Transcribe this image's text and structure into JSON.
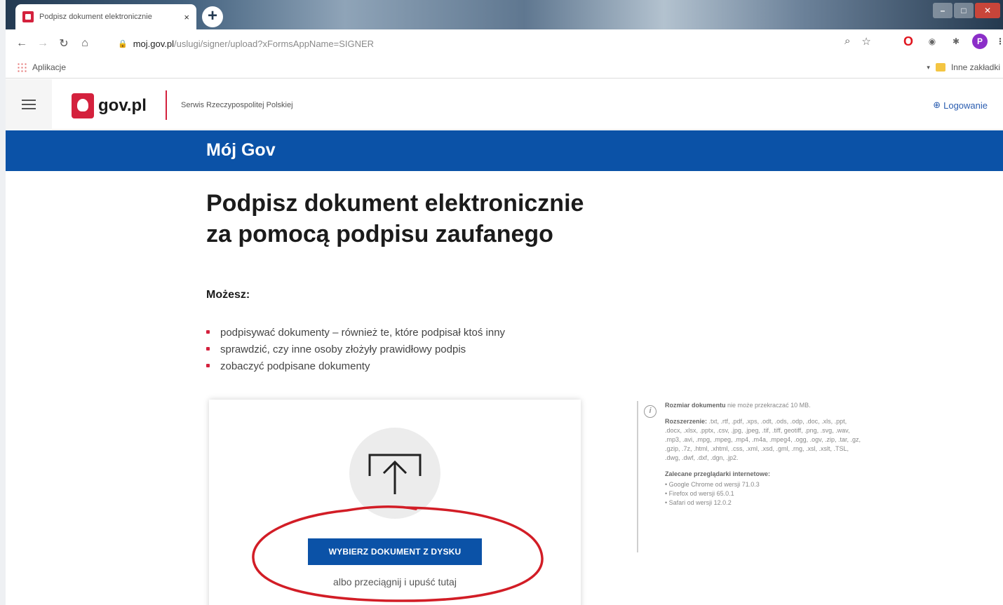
{
  "browser": {
    "tab_title": "Podpisz dokument elektronicznie",
    "tab_close": "×",
    "new_tab": "+",
    "url_host": "moj.gov.pl",
    "url_path": "/uslugi/signer/upload?xFormsAppName=SIGNER",
    "bookmarks": {
      "apps": "Aplikacje",
      "other": "Inne zakładki"
    }
  },
  "site": {
    "logo_text": "gov.pl",
    "tagline": "Serwis Rzeczypospolitej Polskiej",
    "login": "Logowanie",
    "banner_title": "Mój Gov"
  },
  "main": {
    "title_line1": "Podpisz dokument elektronicznie",
    "title_line2": "za pomocą podpisu zaufanego",
    "can_label": "Możesz:",
    "bullets": [
      "podpisywać dokumenty – również te, które podpisał ktoś inny",
      "sprawdzić, czy inne osoby złożyły prawidłowy podpis",
      "zobaczyć podpisane dokumenty"
    ],
    "upload_button": "WYBIERZ DOKUMENT Z DYSKU",
    "drop_text": "albo przeciągnij i upuść tutaj"
  },
  "info": {
    "size_label": "Rozmiar dokumentu",
    "size_text": "nie może przekraczać 10 MB.",
    "ext_label": "Rozszerzenie:",
    "ext_text": ".txt, .rtf, .pdf, .xps, .odt, .ods, .odp, .doc, .xls, .ppt, .docx, .xlsx, .pptx, .csv, .jpg, .jpeg, .tif, .tiff, geotiff, .png, .svg, .wav, .mp3, .avi, .mpg, .mpeg, .mp4, .m4a, .mpeg4, .ogg, .ogv, .zip, .tar, .gz, .gzip, .7z, .html, .xhtml, .css, .xml, .xsd, .gml, .rng, .xsl, .xslt, .TSL, .dwg, .dwf, .dxf, .dgn, .jp2.",
    "browsers_label": "Zalecane przeglądarki internetowe:",
    "browsers": [
      "• Google Chrome od wersji 71.0.3",
      "• Firefox od wersji 65.0.1",
      "• Safari od wersji 12.0.2"
    ]
  },
  "colors": {
    "brand_blue": "#0b52a7",
    "brand_red": "#d4213d",
    "annotation": "#d21d26"
  }
}
